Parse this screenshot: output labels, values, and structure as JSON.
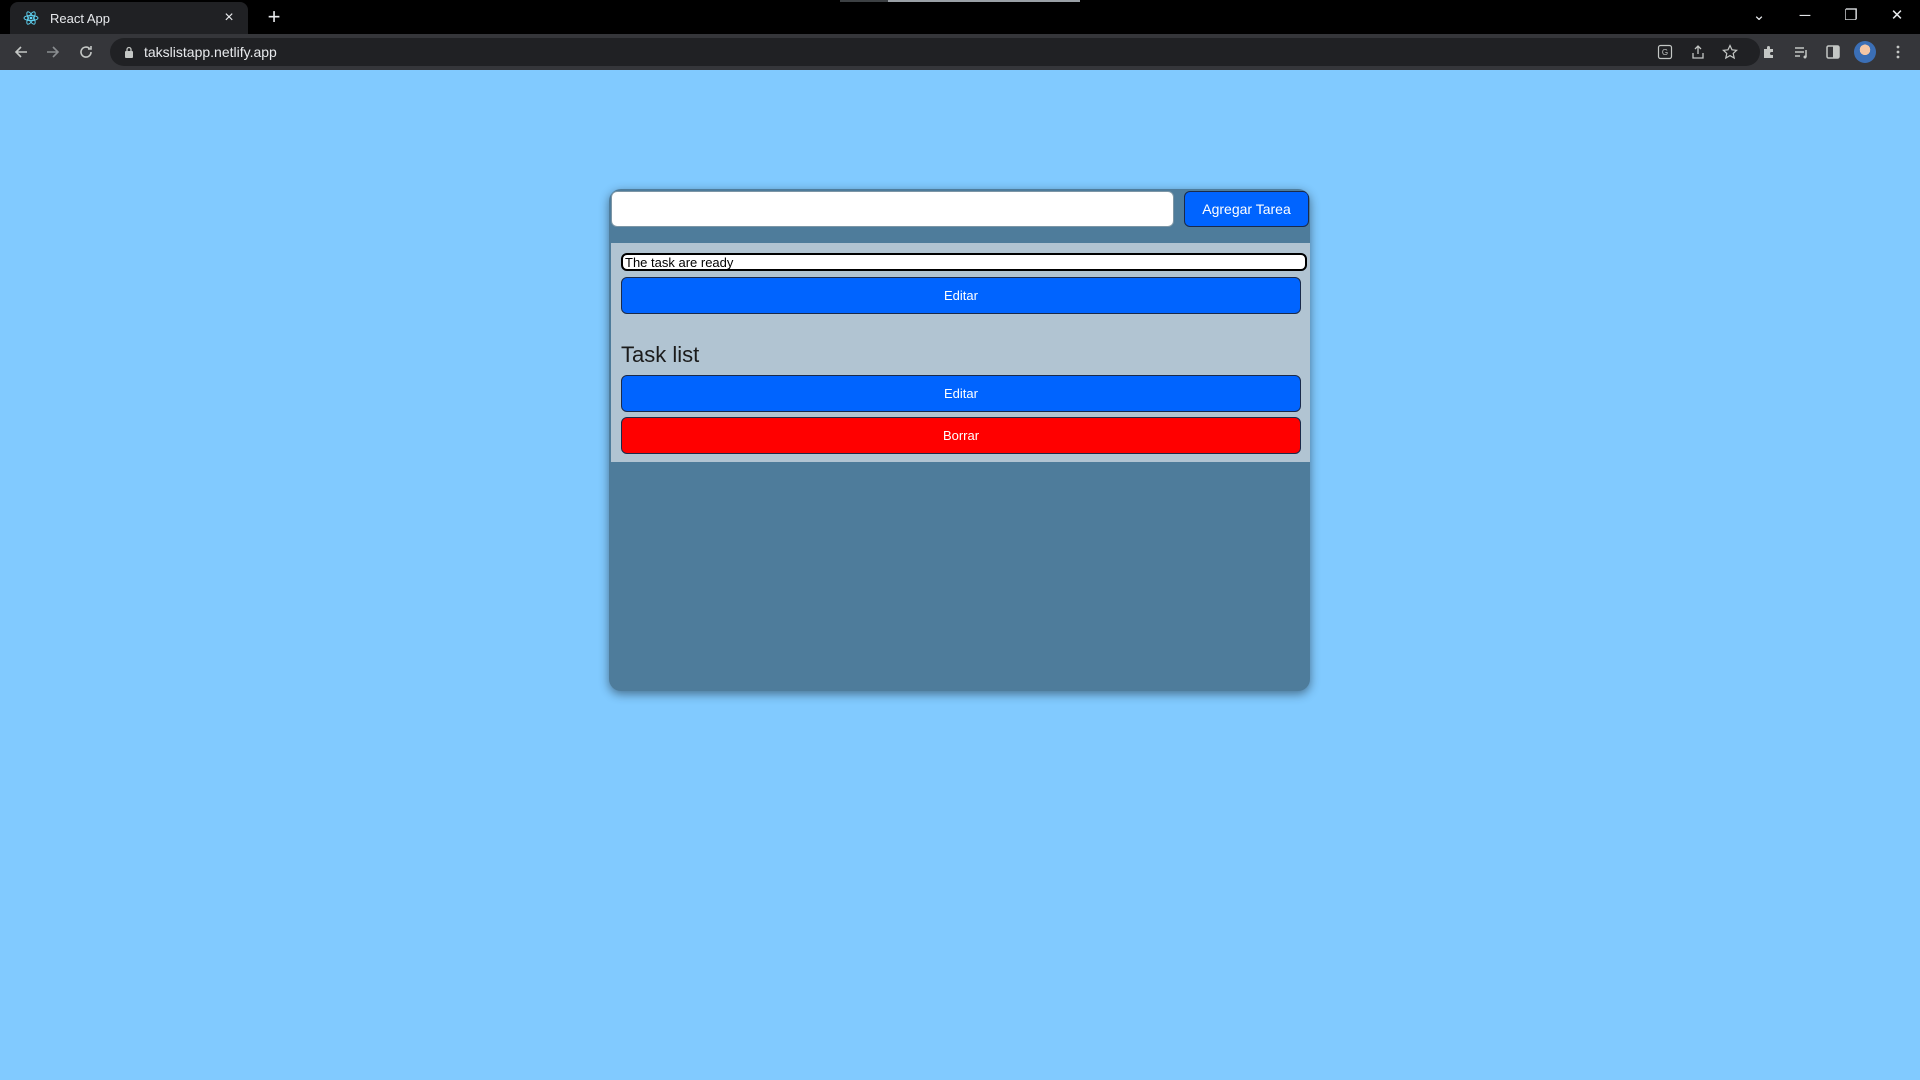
{
  "browser": {
    "tab_title": "React App",
    "tab_close": "×",
    "new_tab": "+",
    "url": "takslistapp.netlify.app",
    "window_controls": {
      "chevron": "⌄",
      "minimize": "─",
      "restore": "❐",
      "close": "✕"
    }
  },
  "app": {
    "input": {
      "value": "",
      "placeholder": ""
    },
    "add_button": "Agregar Tarea",
    "edit_field_value": "The task are ready",
    "edit_button": "Editar",
    "list_title": "Task list",
    "task_edit_button": "Editar",
    "delete_button": "Borrar"
  },
  "colors": {
    "page_background": "#81caff",
    "card_background": "#4e7c9b",
    "panel_background": "#b1c4d2",
    "primary_button": "#0064ff",
    "danger_button": "#ff0000"
  }
}
